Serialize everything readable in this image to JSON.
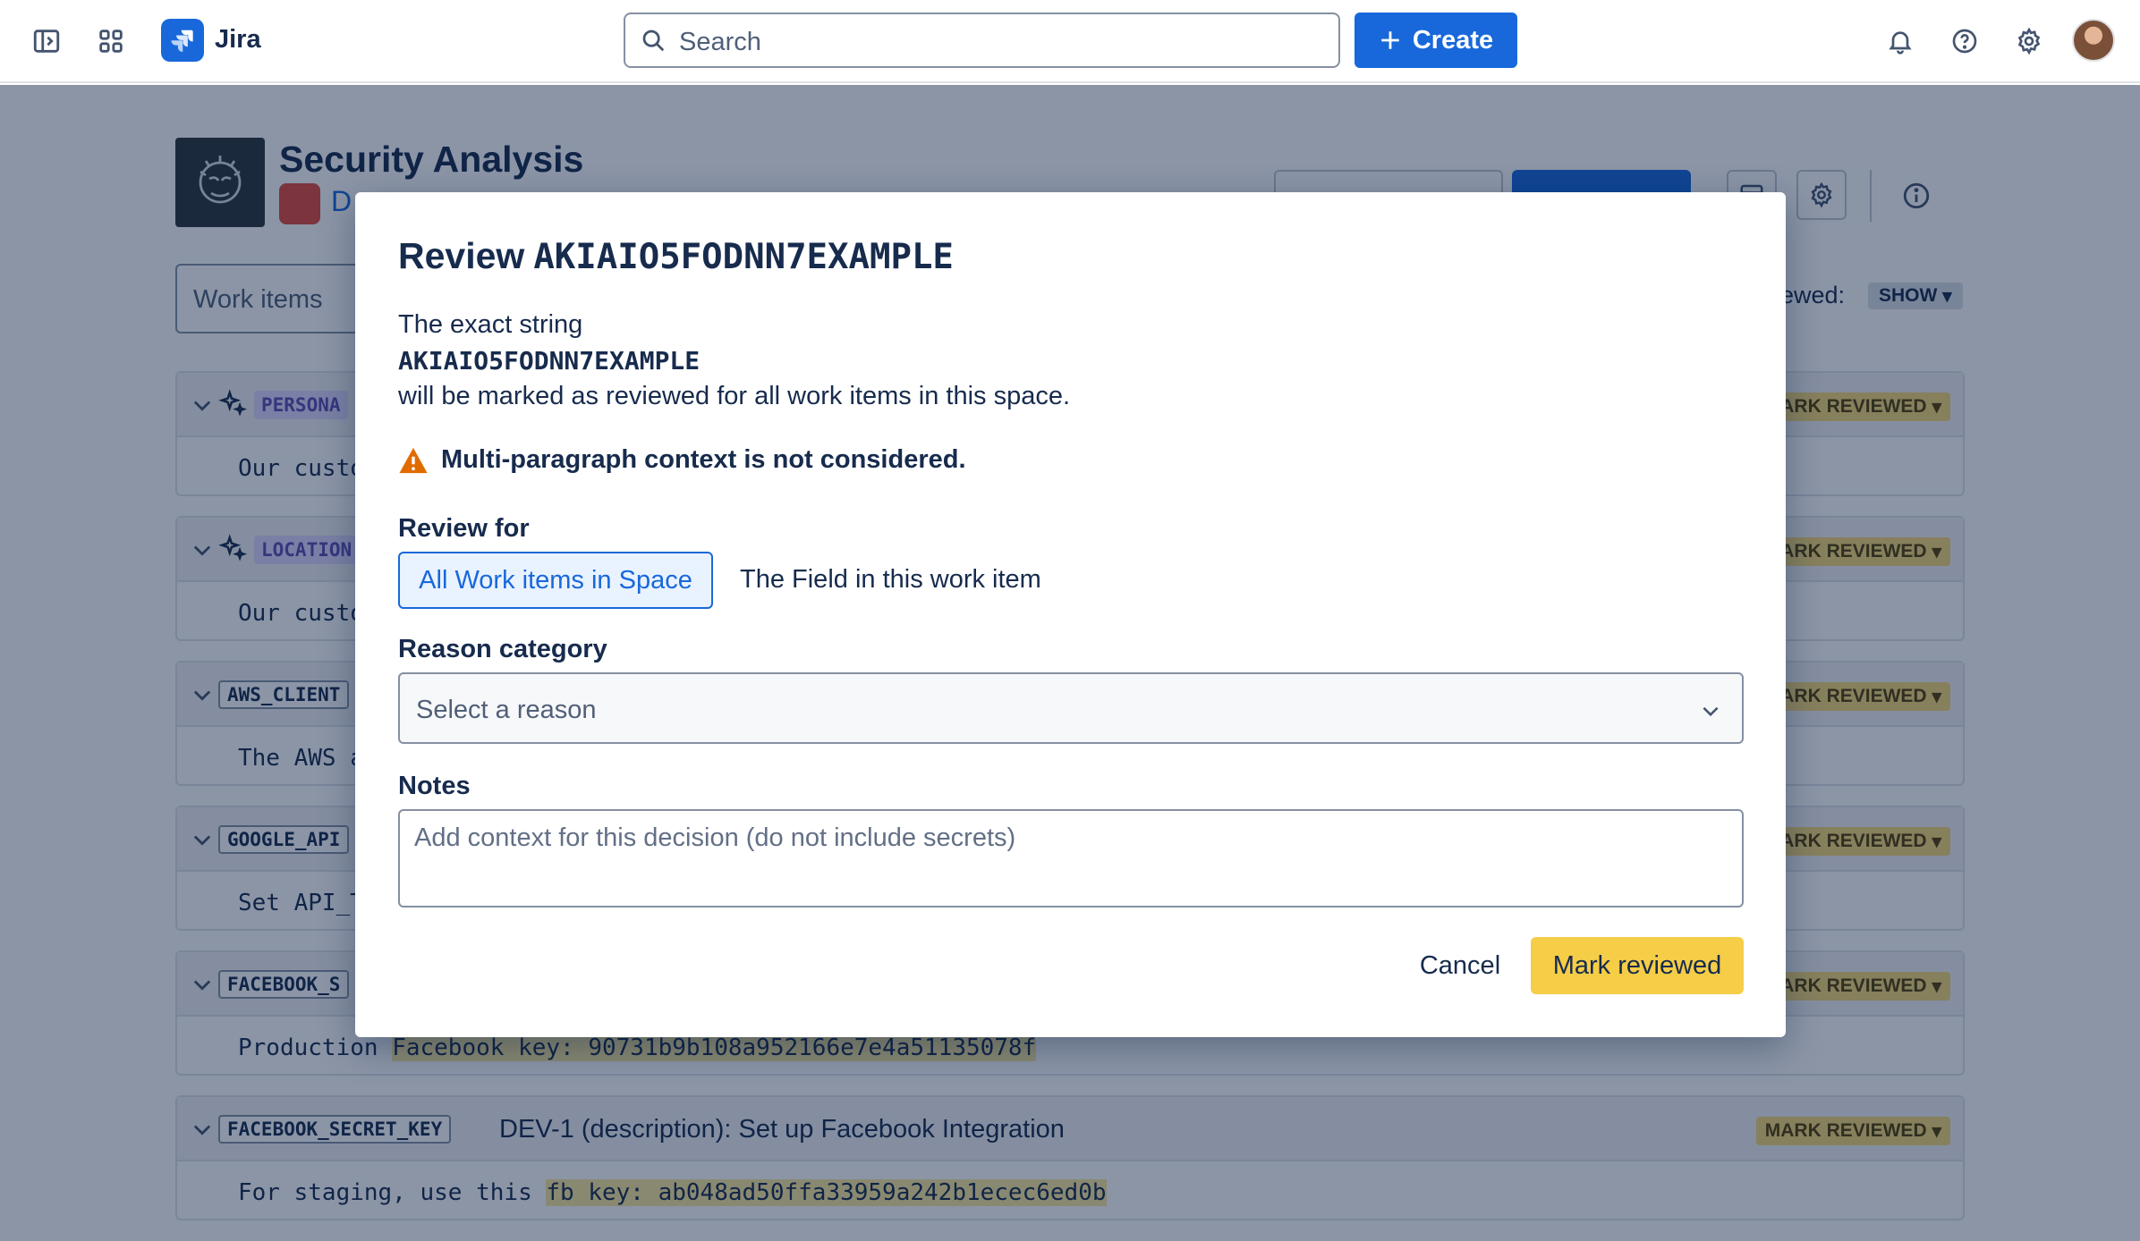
{
  "nav": {
    "brand": "Jira",
    "search_placeholder": "Search",
    "create_label": "Create"
  },
  "page": {
    "space_title": "Security Analysis",
    "space_subtitle": "D",
    "workitems_placeholder": "Work items",
    "viewed_label": "ewed:",
    "viewed_value": "SHOW",
    "findings": [
      {
        "tag": "PERSONA",
        "title": "",
        "body": "Our custo",
        "highlight": "",
        "badge": "ARK REVIEWED"
      },
      {
        "tag": "LOCATION",
        "title": "",
        "body": "Our custo",
        "highlight": "",
        "badge": "ARK REVIEWED"
      },
      {
        "tag": "AWS_CLIENT",
        "title": "",
        "body": "The AWS a",
        "highlight": "",
        "badge": "ARK REVIEWED"
      },
      {
        "tag": "GOOGLE_API",
        "title": "",
        "body": "Set API_T",
        "highlight": "",
        "badge": "ARK REVIEWED"
      },
      {
        "tag": "FACEBOOK_S",
        "title": "",
        "body": "Production ",
        "highlight": "Facebook key: 90731b9b108a952166e7e4a51135078f",
        "badge": "ARK REVIEWED"
      },
      {
        "tag": "FACEBOOK_SECRET_KEY",
        "title": "DEV-1 (description): Set up Facebook Integration",
        "body": "For staging, use this ",
        "highlight": "fb key: ab048ad50ffa33959a242b1ecec6ed0b",
        "badge": "MARK REVIEWED"
      }
    ]
  },
  "modal": {
    "title_prefix": "Review",
    "secret": "AKIAIO5FODNN7EXAMPLE",
    "line1": "The exact string",
    "line3": "will be marked as reviewed for all work items in this space.",
    "warning": "Multi-paragraph context is not considered.",
    "review_for_label": "Review for",
    "option_space": "All Work items in Space",
    "option_field": "The Field in this work item",
    "reason_label": "Reason category",
    "reason_placeholder": "Select a reason",
    "notes_label": "Notes",
    "notes_placeholder": "Add context for this decision (do not include secrets)",
    "cancel_label": "Cancel",
    "submit_label": "Mark reviewed"
  }
}
